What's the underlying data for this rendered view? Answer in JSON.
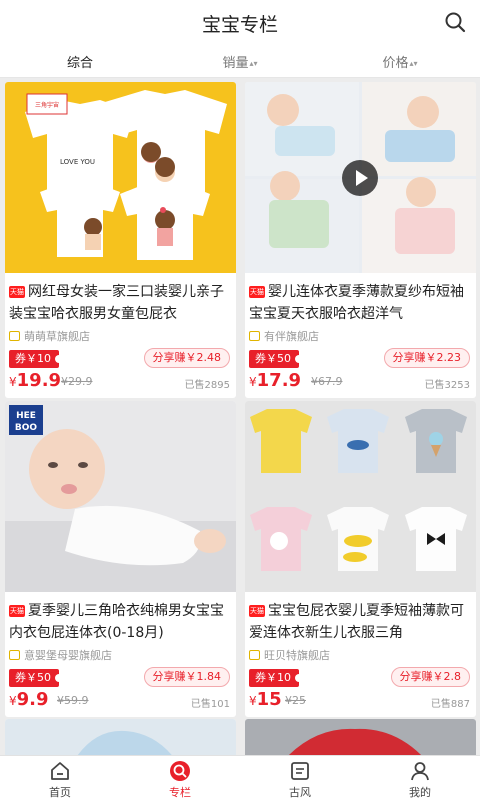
{
  "header": {
    "title": "宝宝专栏",
    "search_icon": "search-icon"
  },
  "sort": {
    "items": [
      "综合",
      "销量",
      "价格"
    ],
    "active": 0
  },
  "products": [
    {
      "name": "网红母女装一家三口装婴儿亲子装宝宝哈衣服男女童包屁衣",
      "shop": "萌萌草旗舰店",
      "coupon": "券￥10",
      "share": "分享赚￥2.48",
      "currency": "¥",
      "price": "19.9",
      "orig": "¥29.9",
      "sold": "已售2895",
      "tag": "天猫"
    },
    {
      "name": "婴儿连体衣夏季薄款夏纱布短袖宝宝夏天衣服哈衣超洋气",
      "shop": "有伴旗舰店",
      "coupon": "券￥50",
      "share": "分享赚￥2.23",
      "currency": "¥",
      "price": "17.9",
      "orig": "¥67.9",
      "sold": "已售3253",
      "tag": "天猫"
    },
    {
      "name": "夏季婴儿三角哈衣纯棉男女宝宝内衣包屁连体衣(0-18月)",
      "shop": "意婴堡母婴旗舰店",
      "coupon": "券￥50",
      "share": "分享赚￥1.84",
      "currency": "¥",
      "price": "9.9",
      "orig": "¥59.9",
      "sold": "已售101",
      "tag": "天猫"
    },
    {
      "name": "宝宝包屁衣婴儿夏季短袖薄款可爱连体衣新生儿衣服三角",
      "shop": "旺贝特旗舰店",
      "coupon": "券￥10",
      "share": "分享赚￥2.8",
      "currency": "¥",
      "price": "15",
      "orig": "¥25",
      "sold": "已售887",
      "tag": "天猫"
    }
  ],
  "image_text": {
    "love_you": "LOVE YOU",
    "heeboo_1": "HEE",
    "heeboo_2": "BOO"
  },
  "tabbar": {
    "items": [
      "首页",
      "专栏",
      "古风",
      "我的"
    ],
    "active": 1
  },
  "colors": {
    "accent": "#e8202a",
    "yellow_bg": "#f6c21d"
  }
}
